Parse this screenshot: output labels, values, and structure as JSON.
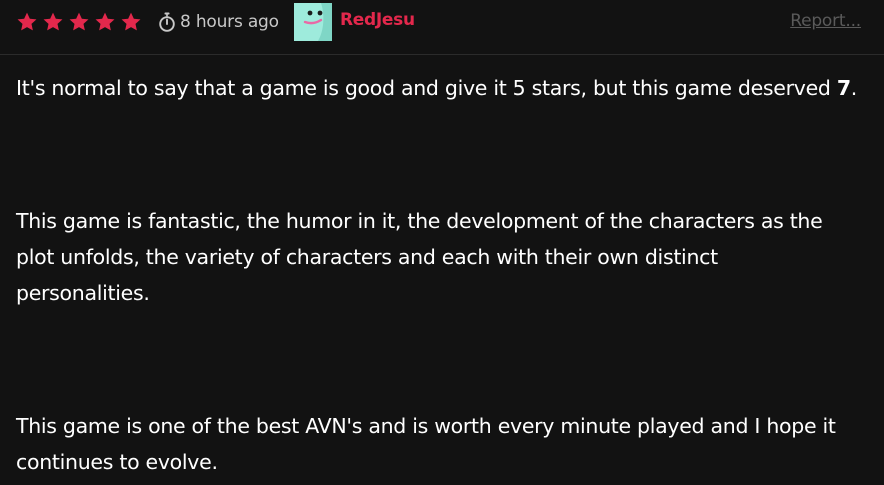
{
  "review": {
    "rating": 5,
    "rating_max": 5,
    "star_color": "#e3284c",
    "timestamp": "8 hours ago",
    "timer_icon": "stopwatch-icon",
    "avatar_icon": "smiling-face-avatar",
    "username": "RedJesu",
    "username_color": "#e3284c",
    "report_label": "Report...",
    "paragraph1_text": "It's normal to say that a game is good and give it 5 stars, but this game deserved ",
    "paragraph1_emphasis": "7",
    "paragraph1_end": ".",
    "paragraph2": "This game is fantastic, the humor in it, the development of the characters as the plot unfolds, the variety of characters and each with their own distinct personalities.",
    "paragraph3": "This game is one of the best AVN's and is worth every minute played and I hope it continues to evolve."
  }
}
